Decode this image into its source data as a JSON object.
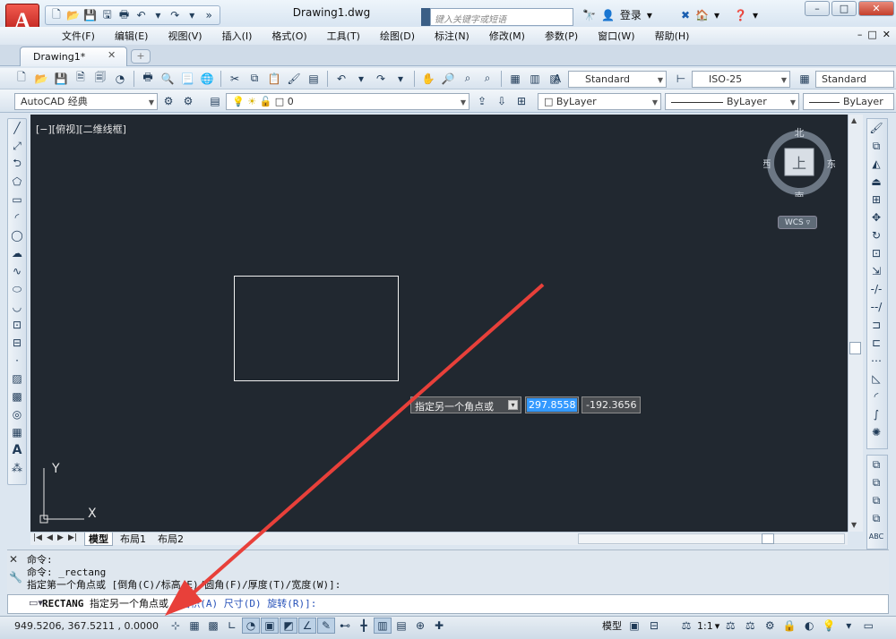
{
  "app": {
    "title": "Drawing1.dwg",
    "logo_letter": "A",
    "search_placeholder": "键入关键字或短语",
    "login_label": "登录"
  },
  "window_controls": {
    "min": "–",
    "restore": "□",
    "close": "✕"
  },
  "menu": [
    "文件(F)",
    "编辑(E)",
    "视图(V)",
    "插入(I)",
    "格式(O)",
    "工具(T)",
    "绘图(D)",
    "标注(N)",
    "修改(M)",
    "参数(P)",
    "窗口(W)",
    "帮助(H)"
  ],
  "doc_tab": {
    "label": "Drawing1*",
    "close": "✕"
  },
  "toolbar": {
    "text_style": "Standard",
    "dim_style": "ISO-25",
    "table_style": "Standard",
    "workspace": "AutoCAD 经典",
    "layer": "0",
    "color": "ByLayer",
    "linetype": "ByLayer",
    "lineweight": "ByLayer"
  },
  "viewport": {
    "label": "[−][俯视][二维线框]",
    "compass": {
      "north": "北",
      "south": "南",
      "east": "东",
      "west": "西",
      "top": "上"
    },
    "wcs": "WCS"
  },
  "dynamic_input": {
    "prompt": "指定另一个角点或",
    "x_value": "297.8558",
    "y_value": "-192.3656"
  },
  "layout_tabs": [
    "模型",
    "布局1",
    "布局2"
  ],
  "command_history": [
    "命令:",
    "命令: _rectang",
    "指定第一个角点或 [倒角(C)/标高(E)/圆角(F)/厚度(T)/宽度(W)]:"
  ],
  "command_line": {
    "command": "RECTANG",
    "prompt": "指定另一个角点或",
    "options": "[面积(A) 尺寸(D) 旋转(R)]:"
  },
  "status": {
    "coords": "949.5206,  367.5211 , 0.0000",
    "model_label": "模型",
    "scale": "1:1"
  },
  "colors": {
    "canvas": "#212830",
    "arrow": "#e8403a",
    "accent": "#3399ff"
  }
}
